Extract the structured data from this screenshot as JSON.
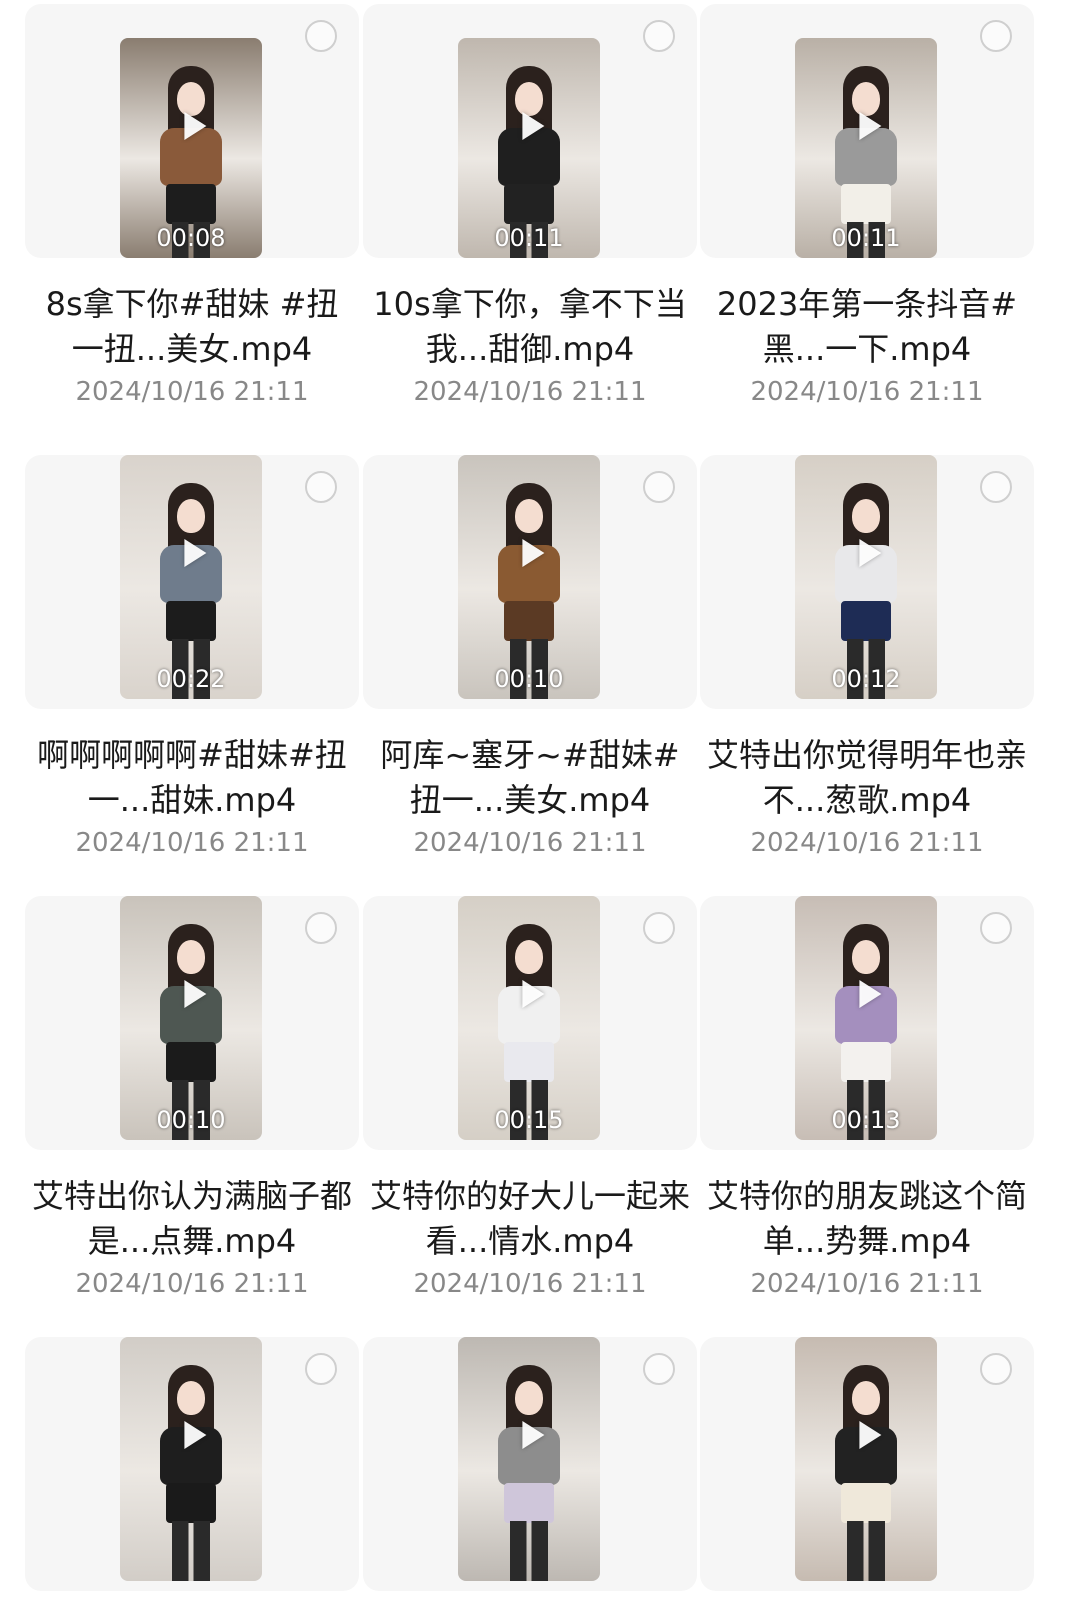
{
  "colors": {
    "card_bg": "#f6f6f6",
    "title_text": "#1a1a1a",
    "date_text": "#888888",
    "select_border": "#cfcfcf"
  },
  "icons": {
    "play": "play-icon",
    "select": "select-circle-icon"
  },
  "videos": [
    {
      "duration": "00:08",
      "title": "8s拿下你#甜妹 #扭一扭...美女.mp4",
      "date": "2024/10/16 21:11",
      "top_color": "#8a5a3a",
      "bottom_color": "#1d1d1d",
      "bg": "#8a7d70"
    },
    {
      "duration": "00:11",
      "title": "10s拿下你，拿不下当我...甜御.mp4",
      "date": "2024/10/16 21:11",
      "top_color": "#1f1f1f",
      "bottom_color": "#222222",
      "bg": "#bfb7ae"
    },
    {
      "duration": "00:11",
      "title": "2023年第一条抖音#黑...一下.mp4",
      "date": "2024/10/16 21:11",
      "top_color": "#9a9a9a",
      "bottom_color": "#f2efe8",
      "bg": "#b9b0a6"
    },
    {
      "duration": "00:22",
      "title": "啊啊啊啊啊#甜妹#扭一...甜妹.mp4",
      "date": "2024/10/16 21:11",
      "top_color": "#6f7c8c",
      "bottom_color": "#1c1c1c",
      "bg": "#d9d3cc"
    },
    {
      "duration": "00:10",
      "title": "阿库~塞牙~#甜妹#扭一...美女.mp4",
      "date": "2024/10/16 21:11",
      "top_color": "#8a5a32",
      "bottom_color": "#5b3a24",
      "bg": "#c9c4bd"
    },
    {
      "duration": "00:12",
      "title": "艾特出你觉得明年也亲不...葱歌.mp4",
      "date": "2024/10/16 21:11",
      "top_color": "#e8e8ea",
      "bottom_color": "#1e2c55",
      "bg": "#d6cfc6"
    },
    {
      "duration": "00:10",
      "title": "艾特出你认为满脑子都是...点舞.mp4",
      "date": "2024/10/16 21:11",
      "top_color": "#4e5752",
      "bottom_color": "#1b1b1b",
      "bg": "#c9c3bb"
    },
    {
      "duration": "00:15",
      "title": "艾特你的好大儿一起来看...情水.mp4",
      "date": "2024/10/16 21:11",
      "top_color": "#f0f0f0",
      "bottom_color": "#e9e9ee",
      "bg": "#d5cfc6"
    },
    {
      "duration": "00:13",
      "title": "艾特你的朋友跳这个简单...势舞.mp4",
      "date": "2024/10/16 21:11",
      "top_color": "#a48fbe",
      "bottom_color": "#f3f1ee",
      "bg": "#c7bdb5"
    },
    {
      "duration": "",
      "title": "",
      "date": "",
      "top_color": "#1e1e1e",
      "bottom_color": "#1a1a1a",
      "bg": "#d2cdc7"
    },
    {
      "duration": "",
      "title": "",
      "date": "",
      "top_color": "#8d8d8d",
      "bottom_color": "#cfc6da",
      "bg": "#bdb8b2"
    },
    {
      "duration": "",
      "title": "",
      "date": "",
      "top_color": "#222222",
      "bottom_color": "#efe8da",
      "bg": "#c6bbb1"
    }
  ]
}
